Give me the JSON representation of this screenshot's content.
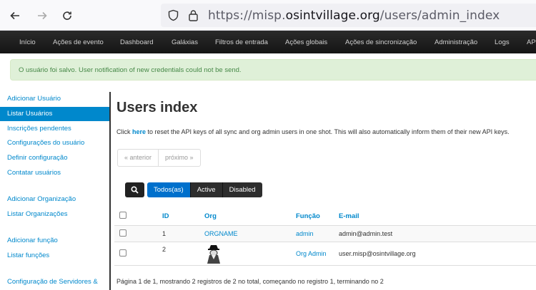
{
  "browser": {
    "url_prefix": "https://misp.",
    "url_domain": "osintvillage.org",
    "url_path": "/users/admin_index"
  },
  "topmenu": [
    "Início",
    "Ações de evento",
    "Dashboard",
    "Galáxias",
    "Filtros de entrada",
    "Ações globais",
    "Ações de sincronização",
    "Administração",
    "Logs",
    "AP"
  ],
  "alert": "O usuário foi salvo. User notification of new credentials could not be send.",
  "sidebar": {
    "items": [
      "Adicionar Usuário",
      "Listar Usuários",
      "Inscrições pendentes",
      "Configurações do usuário",
      "Definir configuração",
      "Contatar usuários",
      "Adicionar Organização",
      "Listar Organizações",
      "Adicionar função",
      "Listar funções",
      "Configuração de Servidores &"
    ]
  },
  "main": {
    "title": "Users index",
    "intro_before": "Click ",
    "intro_link": "here",
    "intro_after": " to reset the API keys of all sync and org admin users in one shot. This will also automatically inform them of their new API keys.",
    "pager_prev": "« anterior",
    "pager_next": "próximo »",
    "filters": [
      "Todos(as)",
      "Active",
      "Disabled"
    ],
    "columns": [
      "ID",
      "Org",
      "Função",
      "E-mail"
    ],
    "rows": [
      {
        "id": "1",
        "org": "ORGNAME",
        "role": "admin",
        "email": "admin@admin.test"
      },
      {
        "id": "2",
        "org": "",
        "role": "Org Admin",
        "email": "user.misp@osintvillage.org"
      }
    ],
    "footer": "Página 1 de 1, mostrando 2 registros de 2 no total, começando no registro 1, terminando no 2"
  }
}
